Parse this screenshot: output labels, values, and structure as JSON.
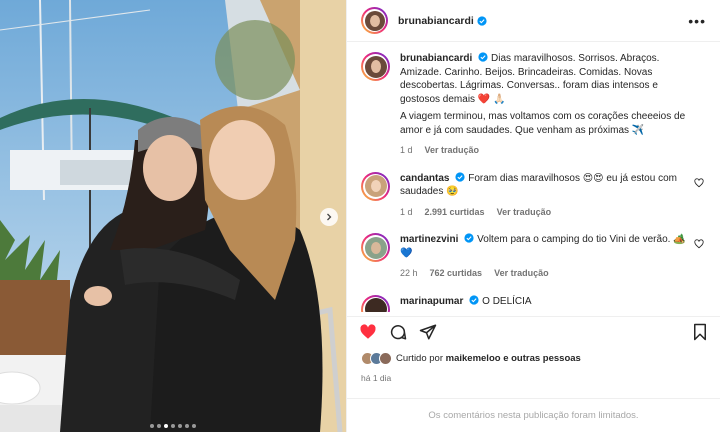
{
  "post": {
    "author": "brunabiancardi",
    "more_icon": "more-horizontal-icon"
  },
  "caption": {
    "username": "brunabiancardi",
    "text": "Dias maravilhosos. Sorrisos. Abraços. Amizade. Carinho. Beijos. Brincadeiras. Comidas. Novas descobertas. Lágrimas. Conversas.. foram dias intensos e gostosos demais ❤️ 🙏🏻",
    "text2": "A viagem terminou, mas voltamos com os corações cheeeios de amor e já com saudades. Que venham as próximas ✈️",
    "age": "1 d",
    "translate": "Ver tradução"
  },
  "comments": [
    {
      "username": "candantas",
      "text": "Foram dias maravilhosos 😍😍 eu já estou com saudades 🥹",
      "age": "1 d",
      "likes": "2.991 curtidas",
      "translate": "Ver tradução"
    },
    {
      "username": "martinezvini",
      "text": "Voltem para o camping do tio Vini de verão. 🏕️💙",
      "age": "22 h",
      "likes": "762 curtidas",
      "translate": "Ver tradução"
    },
    {
      "username": "marinapumar",
      "text": "O DELÍCIA"
    }
  ],
  "liked_by": {
    "prefix": "Curtido por",
    "user": "maikemeloo",
    "suffix": "e outras pessoas"
  },
  "posted_time": "há 1 dia",
  "limited_notice": "Os comentários nesta publicação foram limitados.",
  "colors": {
    "like_red": "#ff3040",
    "verified_blue": "#0095f6",
    "meta_gray": "#737373"
  },
  "carousel": {
    "slide_count": 7,
    "current": 3
  }
}
